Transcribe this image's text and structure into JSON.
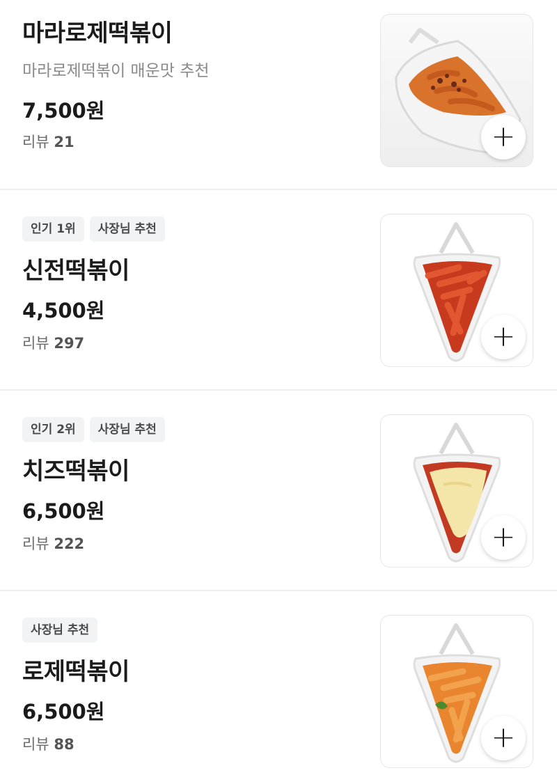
{
  "items": [
    {
      "name": "마라로제떡볶이",
      "description": "마라로제떡볶이 매운맛 추천",
      "badges": [],
      "price": "7,500원",
      "review_label": "리뷰",
      "review_count": "21",
      "add_icon": "plus-icon",
      "image_icon": "mala-rose-tteokbokki-image"
    },
    {
      "name": "신전떡볶이",
      "description": "",
      "badges": [
        "인기 1위",
        "사장님 추천"
      ],
      "price": "4,500원",
      "review_label": "리뷰",
      "review_count": "297",
      "add_icon": "plus-icon",
      "image_icon": "sinjeon-tteokbokki-image"
    },
    {
      "name": "치즈떡볶이",
      "description": "",
      "badges": [
        "인기 2위",
        "사장님 추천"
      ],
      "price": "6,500원",
      "review_label": "리뷰",
      "review_count": "222",
      "add_icon": "plus-icon",
      "image_icon": "cheese-tteokbokki-image"
    },
    {
      "name": "로제떡볶이",
      "description": "",
      "badges": [
        "사장님 추천"
      ],
      "price": "6,500원",
      "review_label": "리뷰",
      "review_count": "88",
      "add_icon": "plus-icon",
      "image_icon": "rose-tteokbokki-image"
    }
  ],
  "colors": {
    "badge_bg": "#f1f3f5",
    "divider": "#eeeeee",
    "sauce_red": "#c73a1e",
    "sauce_rose": "#e8852e",
    "cheese": "#f4e6a8"
  }
}
